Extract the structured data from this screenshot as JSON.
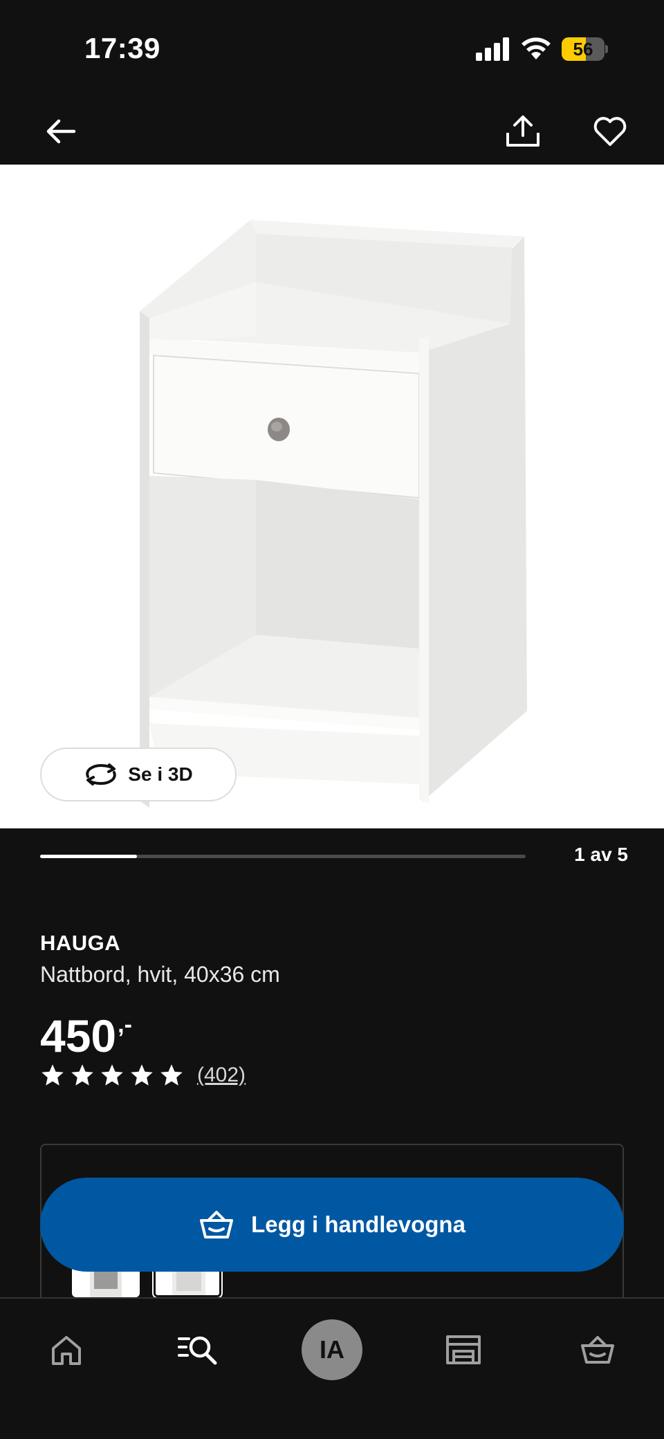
{
  "status_bar": {
    "time": "17:39",
    "battery_level": "56",
    "battery_fraction": 0.56,
    "icons": [
      "signal-icon",
      "wifi-icon",
      "battery-icon"
    ]
  },
  "nav": {
    "icons": [
      "back-arrow-icon",
      "share-icon",
      "heart-icon"
    ]
  },
  "gallery": {
    "view_3d_label": "Se i 3D",
    "counter": "1 av 5",
    "current": 1,
    "total": 5
  },
  "product": {
    "name": "HAUGA",
    "description": "Nattbord, hvit, 40x36 cm",
    "price": "450",
    "price_suffix": ",-",
    "rating": 5,
    "review_count": "(402)"
  },
  "actions": {
    "add_to_cart_label": "Legg i handlevogna"
  },
  "tab_bar": {
    "avatar_initials": "IA",
    "icons": [
      "home-icon",
      "search-icon",
      "avatar",
      "store-icon",
      "cart-icon"
    ]
  },
  "colors": {
    "background": "#111111",
    "accent": "#0058a3",
    "battery": "#ffcc00"
  }
}
